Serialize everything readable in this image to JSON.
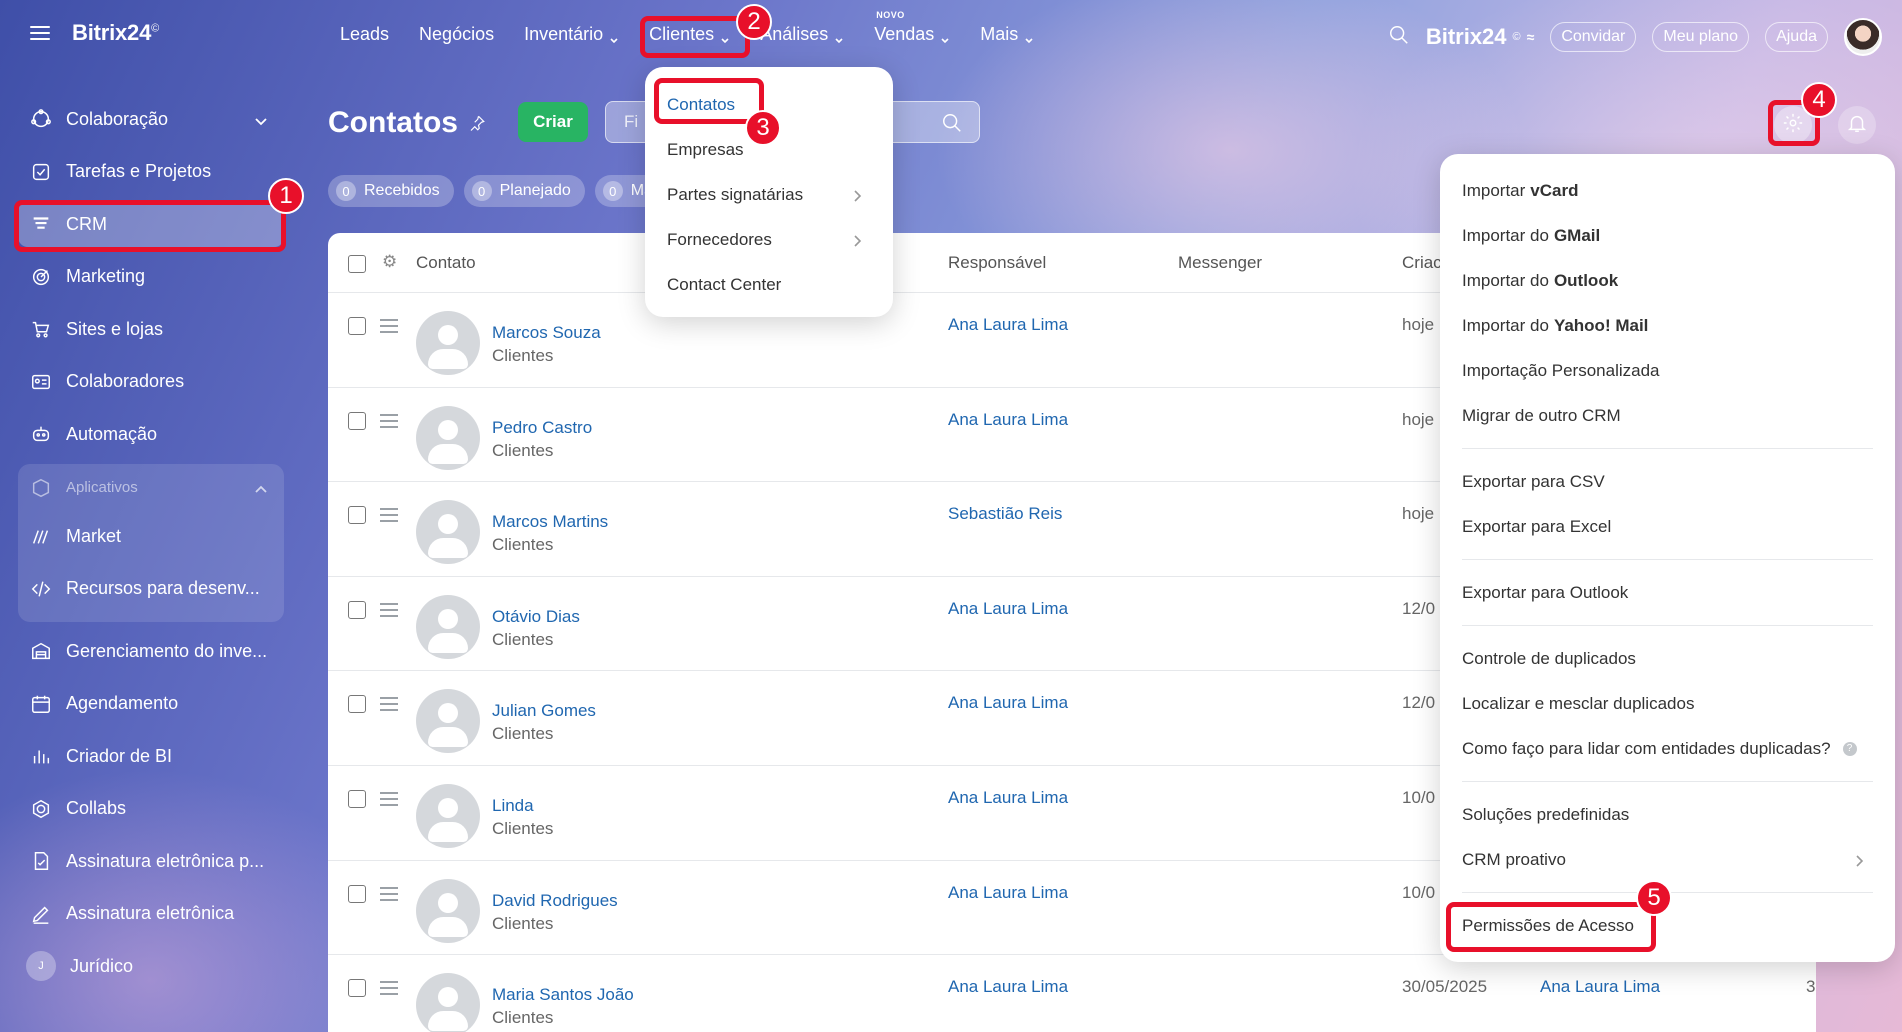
{
  "sidebar": {
    "brand": "Bitrix24",
    "items": [
      {
        "label": "Colaboração",
        "icon": "collaboration-icon"
      },
      {
        "label": "Tarefas e Projetos",
        "icon": "tasks-icon"
      },
      {
        "label": "CRM",
        "icon": "crm-icon"
      },
      {
        "label": "Marketing",
        "icon": "marketing-icon"
      },
      {
        "label": "Sites e lojas",
        "icon": "cart-icon"
      },
      {
        "label": "Colaboradores",
        "icon": "employees-icon"
      },
      {
        "label": "Automação",
        "icon": "automation-icon"
      }
    ],
    "apps_group": {
      "label": "Aplicativos",
      "items": [
        {
          "label": "Market"
        },
        {
          "label": "Recursos para desenv..."
        }
      ]
    },
    "items_bottom": [
      {
        "label": "Gerenciamento do inve..."
      },
      {
        "label": "Agendamento"
      },
      {
        "label": "Criador de BI"
      },
      {
        "label": "Collabs"
      },
      {
        "label": "Assinatura eletrônica p..."
      },
      {
        "label": "Assinatura eletrônica"
      },
      {
        "label": "Jurídico",
        "avatar": "J"
      }
    ]
  },
  "topnav": {
    "tabs": [
      "Leads",
      "Negócios",
      "Inventário",
      "Clientes",
      "Análises",
      "Vendas",
      "Mais"
    ],
    "new_badge": "NOVO",
    "brand": "Bitrix24",
    "invite": "Convidar",
    "plan": "Meu plano",
    "help": "Ajuda"
  },
  "page": {
    "title": "Contatos",
    "create": "Criar",
    "filter_placeholder": "Fi",
    "counters": [
      {
        "num": "0",
        "label": "Recebidos"
      },
      {
        "num": "0",
        "label": "Planejado"
      },
      {
        "num": "0",
        "label": "Ma"
      }
    ]
  },
  "grid": {
    "columns": [
      "Contato",
      "Responsável",
      "Messenger",
      "Criac"
    ],
    "rows": [
      {
        "name": "Marcos Souza",
        "type": "Clientes",
        "resp": "Ana Laura Lima",
        "date": "hoje"
      },
      {
        "name": "Pedro Castro",
        "type": "Clientes",
        "resp": "Ana Laura Lima",
        "date": "hoje"
      },
      {
        "name": "Marcos Martins",
        "type": "Clientes",
        "resp": "Sebastião Reis",
        "date": "hoje"
      },
      {
        "name": "Otávio Dias",
        "type": "Clientes",
        "resp": "Ana Laura Lima",
        "date": "12/0"
      },
      {
        "name": "Julian Gomes",
        "type": "Clientes",
        "resp": "Ana Laura Lima",
        "date": "12/0"
      },
      {
        "name": "Linda",
        "type": "Clientes",
        "resp": "Ana Laura Lima",
        "date": "10/0"
      },
      {
        "name": "David Rodrigues",
        "type": "Clientes",
        "resp": "Ana Laura Lima",
        "date": "10/0"
      },
      {
        "name": "Maria Santos João",
        "type": "Clientes",
        "resp": "Ana Laura Lima",
        "date": "30/05/2025",
        "resp2": "Ana Laura Lima",
        "edge": "3"
      }
    ]
  },
  "clients_menu": {
    "items": [
      "Contatos",
      "Empresas",
      "Partes signatárias",
      "Fornecedores",
      "Contact Center"
    ]
  },
  "settings_menu": {
    "import": [
      {
        "pre": "Importar",
        "bold": "vCard"
      },
      {
        "pre": "Importar do",
        "bold": "GMail"
      },
      {
        "pre": "Importar do",
        "bold": "Outlook"
      },
      {
        "pre": "Importar do",
        "bold": "Yahoo! Mail"
      }
    ],
    "custom_import": "Importação Personalizada",
    "migrate": "Migrar de outro CRM",
    "export_csv": "Exportar para CSV",
    "export_excel": "Exportar para Excel",
    "export_outlook": "Exportar para Outlook",
    "dup_control": "Controle de duplicados",
    "dup_find": "Localizar e mesclar duplicados",
    "dup_help": "Como faço para lidar com entidades duplicadas?",
    "solutions": "Soluções predefinidas",
    "proactive": "CRM proativo",
    "permissions": "Permissões de Acesso"
  },
  "annotations": [
    "1",
    "2",
    "3",
    "4",
    "5"
  ],
  "colors": {
    "highlight": "#e8102a",
    "create": "#28b463",
    "link": "#2067b0"
  }
}
